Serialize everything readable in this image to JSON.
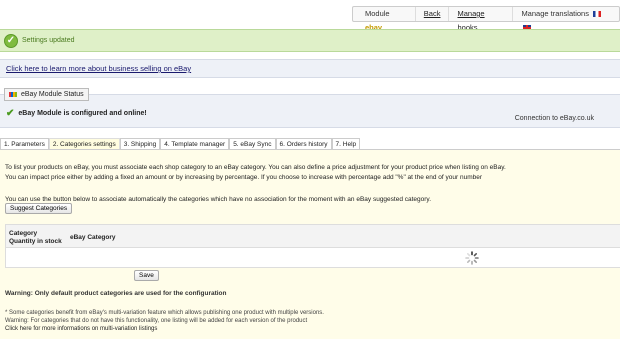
{
  "topnav": {
    "module_label": "Module ",
    "module_brand": "ebay",
    "back": "Back",
    "manage_hooks": "Manage hooks",
    "manage_translations": "Manage translations"
  },
  "notice": {
    "text": "Settings updated"
  },
  "learn_more": {
    "link": "Click here to learn more about business selling on eBay"
  },
  "status": {
    "legend": "eBay Module Status",
    "message": "eBay Module is configured and online!",
    "connection": "Connection to eBay.co.uk"
  },
  "tabs": [
    {
      "label": "1. Parameters"
    },
    {
      "label": "2. Categories settings"
    },
    {
      "label": "3. Shipping"
    },
    {
      "label": "4. Template manager"
    },
    {
      "label": "5. eBay Sync"
    },
    {
      "label": "6. Orders history"
    },
    {
      "label": "7. Help"
    }
  ],
  "active_tab": "2. Categories settings",
  "content": {
    "intro_1": "To list your products on eBay, you must associate each shop category to an eBay category. You can also define a price adjustment for your product price when listing on eBay.",
    "intro_2": "You can impact price either by adding a fixed an amount or by increasing by percentage. If you choose to increase with percentage add \"%\" at the end of your number",
    "suggest_intro": "You can use the button below to associate automatically the categories which have no association for the moment with an eBay suggested category.",
    "suggest_button": "Suggest Categories",
    "table": {
      "col_category": "Category",
      "col_qty": "Quantity in stock",
      "col_ebay": "eBay Category"
    },
    "save_button": "Save",
    "warning": "Warning: Only default product categories are used for the configuration",
    "note_1": "* Some categories benefit from eBay's multi-variation feature which allows publishing one product with multiple versions.",
    "note_2": "Warning: For categories that do not have this functionality, one listing will be added for each version of the product",
    "note_link": "Click here for more informations on multi-variation listings"
  },
  "colors": {
    "success_bg": "#dff0c8",
    "info_bg": "#eef1f7",
    "content_bg": "#fffde9",
    "brand_ebay": "#c49a00"
  }
}
